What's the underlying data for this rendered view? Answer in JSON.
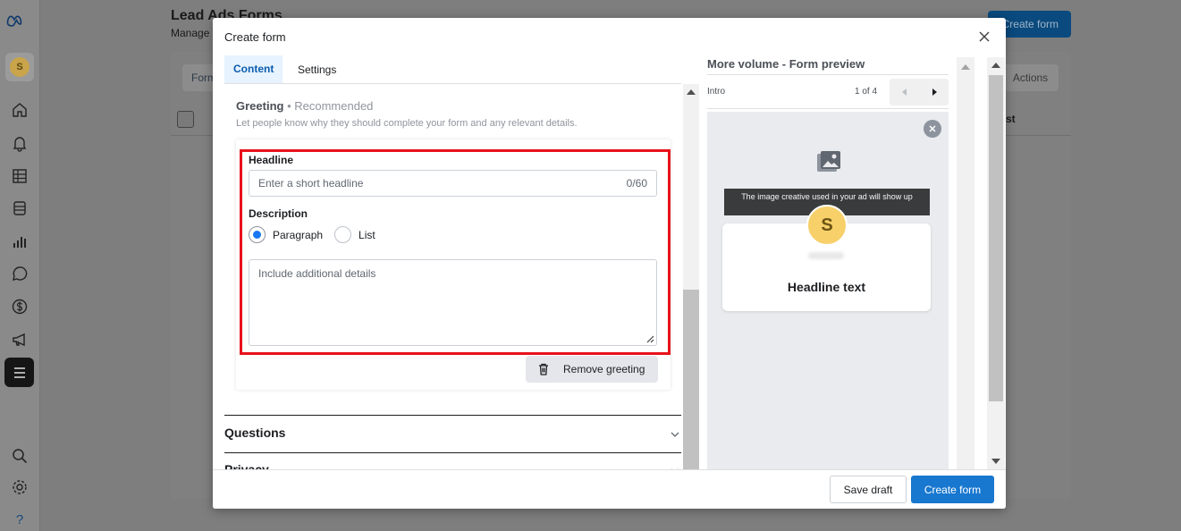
{
  "background": {
    "page_title": "Lead Ads Forms",
    "page_subtitle": "Manage f",
    "create_form_label": "Create form",
    "tab_label": "Form",
    "actions_label": "Actions",
    "column_fragment": "st"
  },
  "sidebar": {
    "items": [
      "meta-logo",
      "avatar",
      "home-icon",
      "bell-icon",
      "table-icon",
      "pages-icon",
      "bar-chart-icon",
      "chat-icon",
      "dollar-icon",
      "megaphone-icon",
      "menu-icon",
      "search-icon",
      "gear-icon",
      "help-icon"
    ],
    "avatar_letter": "S",
    "help_label": "?"
  },
  "modal": {
    "title": "Create form",
    "tabs": [
      {
        "label": "Content",
        "active": true
      },
      {
        "label": "Settings",
        "active": false
      }
    ],
    "greeting": {
      "title": "Greeting",
      "badge": "• Recommended",
      "description": "Let people know why they should complete your form and any relevant details.",
      "headline_label": "Headline",
      "headline_placeholder": "Enter a short headline",
      "headline_counter": "0/60",
      "description_label": "Description",
      "options": [
        {
          "label": "Paragraph",
          "selected": true
        },
        {
          "label": "List",
          "selected": false
        }
      ],
      "details_placeholder": "Include additional details",
      "remove_label": "Remove greeting"
    },
    "sections": [
      {
        "label": "Questions"
      },
      {
        "label": "Privacy"
      }
    ],
    "preview": {
      "title": "More volume - Form preview",
      "step": "Intro",
      "count": "1 of 4",
      "banner": "The image creative used in your ad will show up",
      "avatar_letter": "S",
      "headline": "Headline text"
    },
    "footer": {
      "save_draft": "Save draft",
      "create_form": "Create form"
    }
  },
  "colors": {
    "accent": "#1877cf",
    "highlight_border": "#e8121b",
    "tab_active_bg": "#e7f3ff"
  }
}
